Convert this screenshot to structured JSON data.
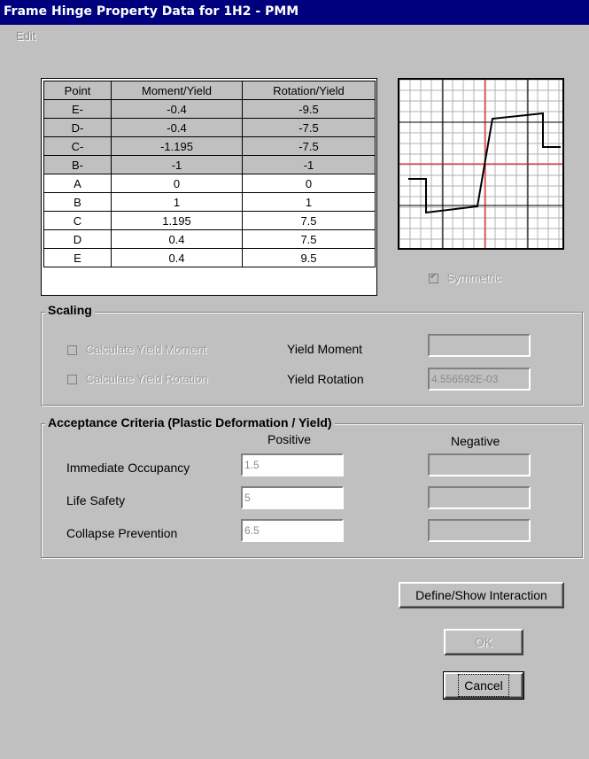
{
  "window": {
    "title": "Frame Hinge Property Data for 1H2 - PMM"
  },
  "menu": {
    "edit": "Edit"
  },
  "table": {
    "headers": [
      "Point",
      "Moment/Yield",
      "Rotation/Yield"
    ],
    "rows": [
      {
        "point": "E-",
        "moment": "-0.4",
        "rotation": "-9.5"
      },
      {
        "point": "D-",
        "moment": "-0.4",
        "rotation": "-7.5"
      },
      {
        "point": "C-",
        "moment": "-1.195",
        "rotation": "-7.5"
      },
      {
        "point": "B-",
        "moment": "-1",
        "rotation": "-1"
      },
      {
        "point": "A",
        "moment": "0",
        "rotation": "0"
      },
      {
        "point": "B",
        "moment": "1",
        "rotation": "1"
      },
      {
        "point": "C",
        "moment": "1.195",
        "rotation": "7.5"
      },
      {
        "point": "D",
        "moment": "0.4",
        "rotation": "7.5"
      },
      {
        "point": "E",
        "moment": "0.4",
        "rotation": "9.5"
      }
    ]
  },
  "symmetric": {
    "label": "Symmetric",
    "checked": true
  },
  "scaling": {
    "title": "Scaling",
    "calc_yield_moment": "Calculate Yield Moment",
    "calc_yield_rotation": "Calculate Yield Rotation",
    "yield_moment_label": "Yield Moment",
    "yield_moment_value": "",
    "yield_rotation_label": "Yield Rotation",
    "yield_rotation_value": "4.556592E-03"
  },
  "acceptance": {
    "title": "Acceptance  Criteria (Plastic Deformation / Yield)",
    "positive_header": "Positive",
    "negative_header": "Negative",
    "rows": [
      {
        "label": "Immediate Occupancy",
        "positive": "1.5",
        "negative": ""
      },
      {
        "label": "Life Safety",
        "positive": "5",
        "negative": ""
      },
      {
        "label": "Collapse Prevention",
        "positive": "6.5",
        "negative": ""
      }
    ]
  },
  "buttons": {
    "define_interaction": "Define/Show Interaction",
    "ok": "OK",
    "cancel": "Cancel"
  },
  "colors": {
    "titlebar": "#00007f",
    "face": "#c0c0c0",
    "plot_axis": "#ff0000"
  }
}
